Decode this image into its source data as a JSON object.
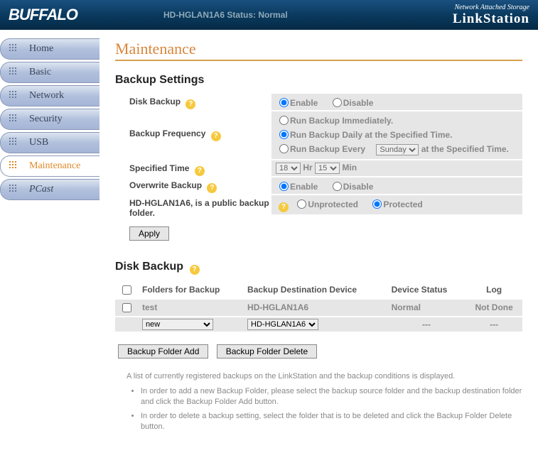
{
  "header": {
    "logo": "BUFFALO",
    "status": "HD-HGLAN1A6 Status: Normal",
    "brand_small": "Network Attached Storage",
    "brand_big": "LinkStation"
  },
  "nav": {
    "items": [
      {
        "label": "Home"
      },
      {
        "label": "Basic"
      },
      {
        "label": "Network"
      },
      {
        "label": "Security"
      },
      {
        "label": "USB"
      },
      {
        "label": "Maintenance",
        "active": true
      },
      {
        "label": "PCast"
      }
    ]
  },
  "page_title": "Maintenance",
  "backup_settings": {
    "title": "Backup Settings",
    "rows": {
      "disk_backup": {
        "label": "Disk Backup",
        "enable": "Enable",
        "disable": "Disable"
      },
      "backup_frequency": {
        "label": "Backup Frequency",
        "opt1": "Run Backup Immediately.",
        "opt2": "Run Backup Daily at the Specified Time.",
        "opt3_pre": "Run Backup Every",
        "opt3_select": "Sunday",
        "opt3_post": "at the Specified Time."
      },
      "specified_time": {
        "label": "Specified Time",
        "hr": "18",
        "hr_label": "Hr",
        "min": "15",
        "min_label": "Min"
      },
      "overwrite": {
        "label": "Overwrite Backup",
        "enable": "Enable",
        "disable": "Disable"
      },
      "public": {
        "label": "HD-HGLAN1A6, is a public backup folder.",
        "unprotected": "Unprotected",
        "protected": "Protected"
      }
    },
    "apply_label": "Apply"
  },
  "disk_backup": {
    "title": "Disk Backup",
    "headers": {
      "check": "",
      "folders": "Folders for Backup",
      "dest": "Backup Destination Device",
      "status": "Device Status",
      "log": "Log"
    },
    "rows": [
      {
        "folder": "test",
        "dest": "HD-HGLAN1A6",
        "status": "Normal",
        "log": "Not Done"
      },
      {
        "folder_select": "new",
        "dest_select": "HD-HGLAN1A6",
        "status": "---",
        "log": "---"
      }
    ],
    "add_btn": "Backup Folder Add",
    "delete_btn": "Backup Folder Delete"
  },
  "notes": {
    "intro": "A list of currently registered backups on the LinkStation and the backup conditions is displayed.",
    "bullets": [
      "In order to add a new Backup Folder, please select the backup source folder and the backup destination folder and click the Backup Folder Add button.",
      "In order to delete a backup setting, select the folder that is to be deleted and click the Backup Folder Delete button."
    ]
  }
}
